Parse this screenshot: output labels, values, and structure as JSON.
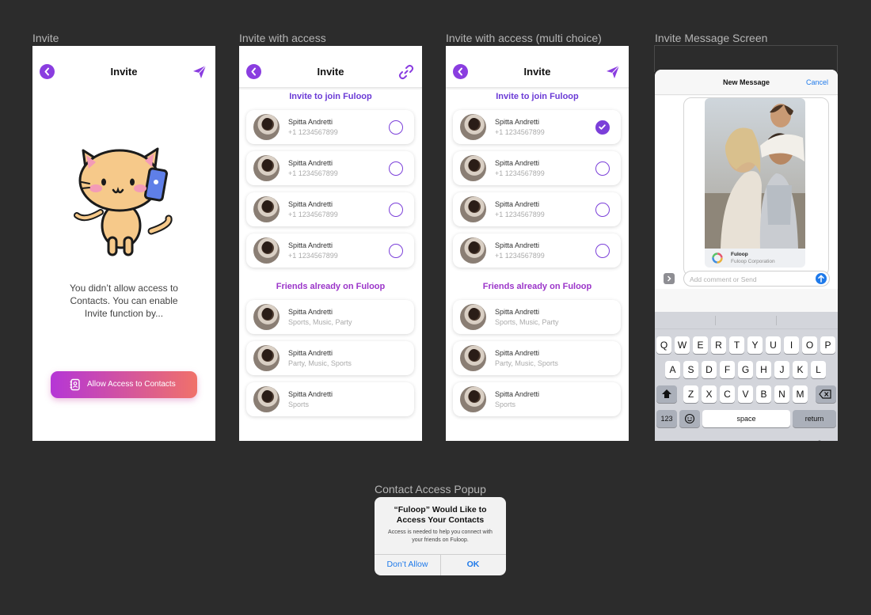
{
  "frames": {
    "invite": "Invite",
    "invite_access": "Invite with access",
    "invite_multi": "Invite with access (multi choice)",
    "message": "Invite Message Screen",
    "popup": "Contact Access Popup"
  },
  "invite_screen": {
    "title": "Invite",
    "message": "You didn’t allow access to Contacts. You can enable Invite function by...",
    "button_label": "Allow Access to Contacts"
  },
  "access_screen": {
    "title": "Invite",
    "invite_section": "Invite to join Fuloop",
    "friends_section": "Friends already on Fuloop",
    "contacts": [
      {
        "name": "Spitta Andretti",
        "phone": "+1 1234567899"
      },
      {
        "name": "Spitta Andretti",
        "phone": "+1 1234567899"
      },
      {
        "name": "Spitta Andretti",
        "phone": "+1 1234567899"
      },
      {
        "name": "Spitta Andretti",
        "phone": "+1 1234567899"
      }
    ],
    "friends": [
      {
        "name": "Spitta Andretti",
        "tags": "Sports, Music, Party"
      },
      {
        "name": "Spitta Andretti",
        "tags": "Party, Music, Sports"
      },
      {
        "name": "Spitta Andretti",
        "tags": "Sports"
      }
    ]
  },
  "multi_screen": {
    "title": "Invite",
    "invite_section": "Invite to join Fuloop",
    "friends_section": "Friends already on Fuloop",
    "contacts": [
      {
        "name": "Spitta Andretti",
        "phone": "+1 1234567899",
        "checked": true
      },
      {
        "name": "Spitta Andretti",
        "phone": "+1 1234567899",
        "checked": false
      },
      {
        "name": "Spitta Andretti",
        "phone": "+1 1234567899",
        "checked": false
      },
      {
        "name": "Spitta Andretti",
        "phone": "+1 1234567899",
        "checked": false
      }
    ],
    "friends": [
      {
        "name": "Spitta Andretti",
        "tags": "Sports, Music, Party"
      },
      {
        "name": "Spitta Andretti",
        "tags": "Party, Music, Sports"
      },
      {
        "name": "Spitta Andretti",
        "tags": "Sports"
      }
    ]
  },
  "message_screen": {
    "title": "New Message",
    "cancel": "Cancel",
    "link_title": "Fuloop",
    "link_subtitle": "Fuloop Corporation",
    "input_placeholder": "Add comment or Send",
    "keyboard": {
      "row1": [
        "Q",
        "W",
        "E",
        "R",
        "T",
        "Y",
        "U",
        "I",
        "O",
        "P"
      ],
      "row2": [
        "A",
        "S",
        "D",
        "F",
        "G",
        "H",
        "J",
        "K",
        "L"
      ],
      "row3": [
        "Z",
        "X",
        "C",
        "V",
        "B",
        "N",
        "M"
      ],
      "numbers": "123",
      "space": "space",
      "return": "return"
    }
  },
  "popup": {
    "title": "“Fuloop” Would Like to Access Your Contacts",
    "message": "Access is needed to help you connect with your friends on Fuloop.",
    "deny": "Don’t Allow",
    "ok": "OK"
  },
  "colors": {
    "accent": "#8a3de0",
    "gradient_start": "#b536d6",
    "gradient_end": "#f0716a",
    "ios_blue": "#1f7aea"
  }
}
